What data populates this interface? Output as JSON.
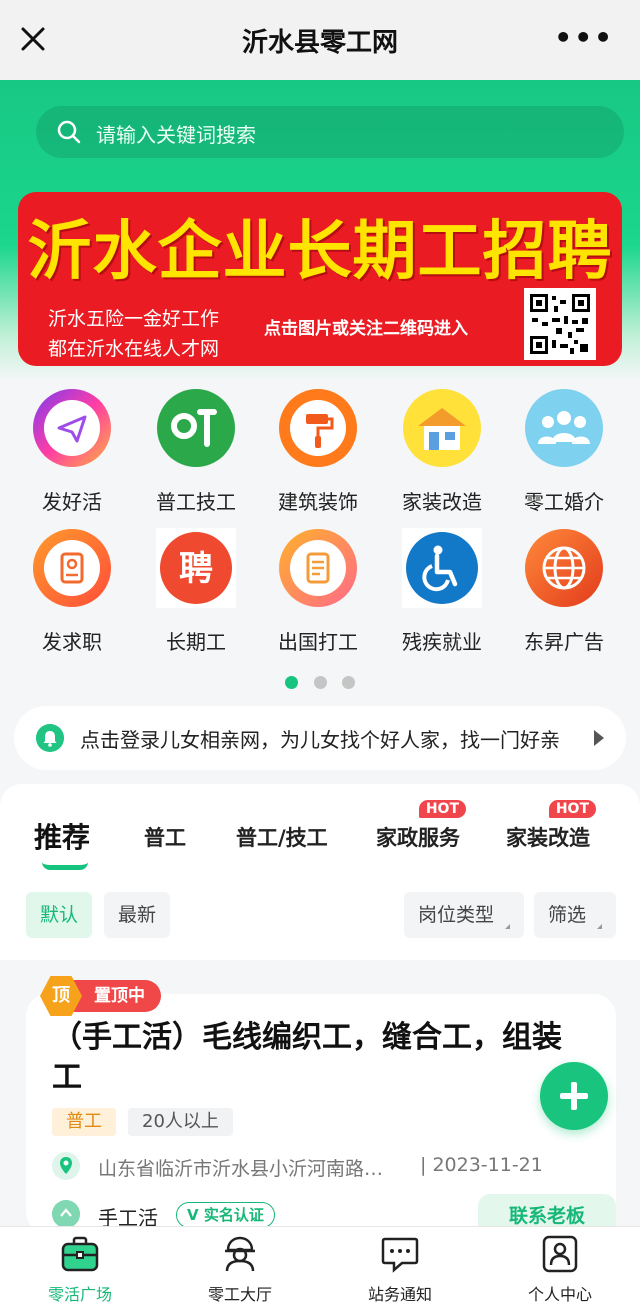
{
  "app": {
    "title": "沂水县零工网"
  },
  "search": {
    "placeholder": "请输入关键词搜索"
  },
  "banner": {
    "headline": "沂水企业长期工招聘",
    "line1": "沂水五险一金好工作",
    "line2": "都在沂水在线人才网",
    "cta": "点击图片或关注二维码进入"
  },
  "grid": [
    {
      "label": "发好活",
      "icon": "send-icon"
    },
    {
      "label": "普工技工",
      "icon": "tools-icon"
    },
    {
      "label": "建筑装饰",
      "icon": "paint-roller-icon"
    },
    {
      "label": "家装改造",
      "icon": "house-icon"
    },
    {
      "label": "零工婚介",
      "icon": "people-icon"
    },
    {
      "label": "发求职",
      "icon": "resume-icon"
    },
    {
      "label": "长期工",
      "icon": "hire-icon"
    },
    {
      "label": "出国打工",
      "icon": "document-icon"
    },
    {
      "label": "残疾就业",
      "icon": "wheelchair-icon"
    },
    {
      "label": "东昇广告",
      "icon": "globe-icon"
    }
  ],
  "pager": {
    "total": 3,
    "active": 1
  },
  "notice": {
    "text": "点击登录儿女相亲网，为儿女找个好人家，找一门好亲"
  },
  "tabs": [
    {
      "label": "推荐",
      "active": true
    },
    {
      "label": "普工"
    },
    {
      "label": "普工/技工"
    },
    {
      "label": "家政服务",
      "badge": "HOT"
    },
    {
      "label": "家装改造",
      "badge": "HOT"
    }
  ],
  "filters": {
    "default": "默认",
    "latest": "最新",
    "type": "岗位类型",
    "filter": "筛选"
  },
  "job": {
    "pin_badge": "顶",
    "pin_label": "置顶中",
    "title": "（手工活）毛线编织工，缝合工，组装工",
    "tags": [
      "普工",
      "20人以上"
    ],
    "address": "山东省临沂市沂水县小沂河南路…",
    "date": "| 2023-11-21",
    "poster": "手工活",
    "verified": "V 实名认证",
    "contact": "联系老板"
  },
  "nav": [
    {
      "label": "零活广场",
      "icon": "briefcase-icon",
      "active": true
    },
    {
      "label": "零工大厅",
      "icon": "worker-icon"
    },
    {
      "label": "站务通知",
      "icon": "message-icon"
    },
    {
      "label": "个人中心",
      "icon": "user-icon"
    }
  ],
  "colors": {
    "brand": "#17c47f",
    "banner": "#ea1b22",
    "banner_text": "#ffe400",
    "hot": "#f0464b",
    "pin": "#f6a21a"
  }
}
